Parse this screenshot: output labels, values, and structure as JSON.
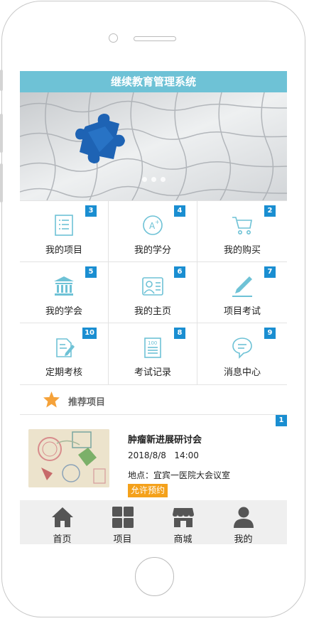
{
  "app": {
    "title": "继续教育管理系统"
  },
  "menu": [
    {
      "label": "我的项目",
      "badge": "3",
      "icon": "list-icon"
    },
    {
      "label": "我的学分",
      "badge": "4",
      "icon": "grade-icon"
    },
    {
      "label": "我的购买",
      "badge": "2",
      "icon": "cart-icon"
    },
    {
      "label": "我的学会",
      "badge": "5",
      "icon": "institution-icon"
    },
    {
      "label": "我的主页",
      "badge": "6",
      "icon": "profile-card-icon"
    },
    {
      "label": "项目考试",
      "badge": "7",
      "icon": "pen-icon"
    },
    {
      "label": "定期考核",
      "badge": "10",
      "icon": "edit-document-icon"
    },
    {
      "label": "考试记录",
      "badge": "8",
      "icon": "score-record-icon"
    },
    {
      "label": "消息中心",
      "badge": "9",
      "icon": "chat-bubble-icon"
    }
  ],
  "recommend": {
    "title": "推荐项目",
    "items": [
      {
        "badge": "1",
        "name": "肿瘤新进展研讨会",
        "date": "2018/8/8   14:00",
        "location": "地点：宜宾一医院大会议室",
        "action": "允许预约"
      }
    ]
  },
  "tabs": [
    {
      "label": "首页",
      "icon": "home-icon"
    },
    {
      "label": "项目",
      "icon": "grid-icon"
    },
    {
      "label": "商城",
      "icon": "store-icon"
    },
    {
      "label": "我的",
      "icon": "user-icon"
    }
  ],
  "colors": {
    "header": "#6ec2d6",
    "badge": "#1a8ed1",
    "button": "#f4a11b",
    "icon": "#6ec2d6",
    "star": "#f5a23a"
  }
}
